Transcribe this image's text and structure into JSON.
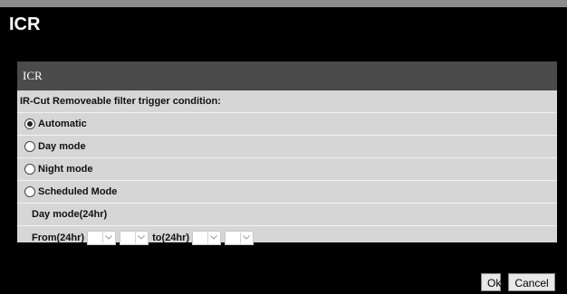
{
  "dialog": {
    "title": "ICR"
  },
  "panel": {
    "header": "ICR",
    "condition_label": "IR-Cut Removeable filter trigger condition:",
    "options": [
      {
        "label": "Automatic",
        "checked": true
      },
      {
        "label": "Day mode",
        "checked": false
      },
      {
        "label": "Night mode",
        "checked": false
      },
      {
        "label": "Scheduled Mode",
        "checked": false
      }
    ],
    "day_mode_label": "Day mode(24hr)",
    "from_label": "From(24hr)",
    "to_label": "to(24hr)",
    "from_hour": "",
    "from_minute": "",
    "to_hour": "",
    "to_minute": ""
  },
  "buttons": {
    "ok": "Ok",
    "cancel": "Cancel"
  }
}
